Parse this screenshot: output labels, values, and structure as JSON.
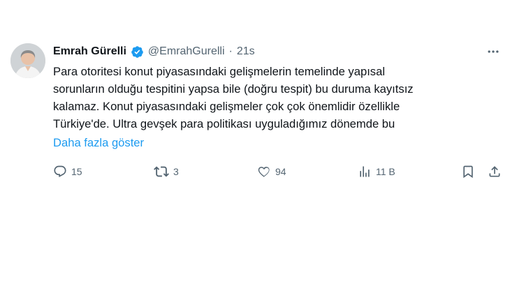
{
  "tweet": {
    "author_name": "Emrah Gürelli",
    "handle": "@EmrahGurelli",
    "separator": "·",
    "time": "21s",
    "lines": [
      "Para otoritesi konut piyasasındaki gelişmelerin temelinde  yapısal",
      "sorunların olduğu tespitini yapsa bile (doğru tespit) bu duruma kayıtsız",
      "kalamaz. Konut piyasasındaki gelişmeler çok çok önemlidir özellikle",
      "Türkiye'de. Ultra gevşek  para politikası uyguladığımız dönemde bu"
    ],
    "show_more": "Daha fazla göster",
    "reply_count": "15",
    "retweet_count": "3",
    "like_count": "94",
    "view_count": "11 B"
  },
  "colors": {
    "verified": "#1d9bf0",
    "link": "#1d9bf0",
    "muted": "#536471"
  },
  "icons": [
    "verified-badge-icon",
    "more-icon",
    "reply-icon",
    "retweet-icon",
    "like-icon",
    "views-icon",
    "bookmark-icon",
    "share-icon"
  ]
}
